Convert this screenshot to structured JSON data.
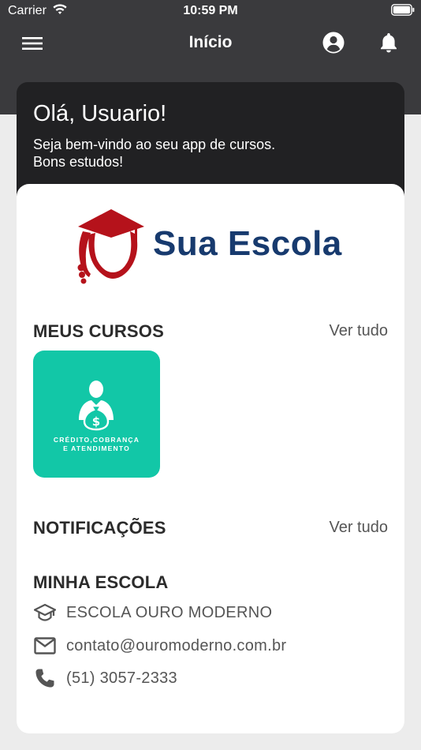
{
  "status_bar": {
    "carrier": "Carrier",
    "time": "10:59 PM"
  },
  "navbar": {
    "title": "Início",
    "menu_icon": "hamburger-menu-icon",
    "user_icon": "user-circle-icon",
    "bell_icon": "bell-icon"
  },
  "welcome": {
    "greeting": "Olá, Usuario!",
    "line1": "Seja bem-vindo ao seu app de cursos.",
    "line2": "Bons estudos!"
  },
  "logo": {
    "text": "Sua Escola",
    "text_color": "#173a6e",
    "icon_color": "#b5121b"
  },
  "courses": {
    "title": "MEUS CURSOS",
    "see_all": "Ver tudo",
    "items": [
      {
        "label_line1": "CRÉDITO,COBRANÇA",
        "label_line2": "E ATENDIMENTO",
        "color": "#12c7a7",
        "icon": "person-money-bag-icon"
      }
    ]
  },
  "notifications": {
    "title": "NOTIFICAÇÕES",
    "see_all": "Ver tudo"
  },
  "school": {
    "title": "MINHA ESCOLA",
    "name": "ESCOLA OURO MODERNO",
    "email": "contato@ouromoderno.com.br",
    "phone": "(51) 3057-2333",
    "name_icon": "graduation-cap-icon",
    "email_icon": "envelope-icon",
    "phone_icon": "phone-icon"
  },
  "colors": {
    "header_bg": "#3a3a3d",
    "welcome_bg": "#212123",
    "page_bg": "#ececec"
  }
}
